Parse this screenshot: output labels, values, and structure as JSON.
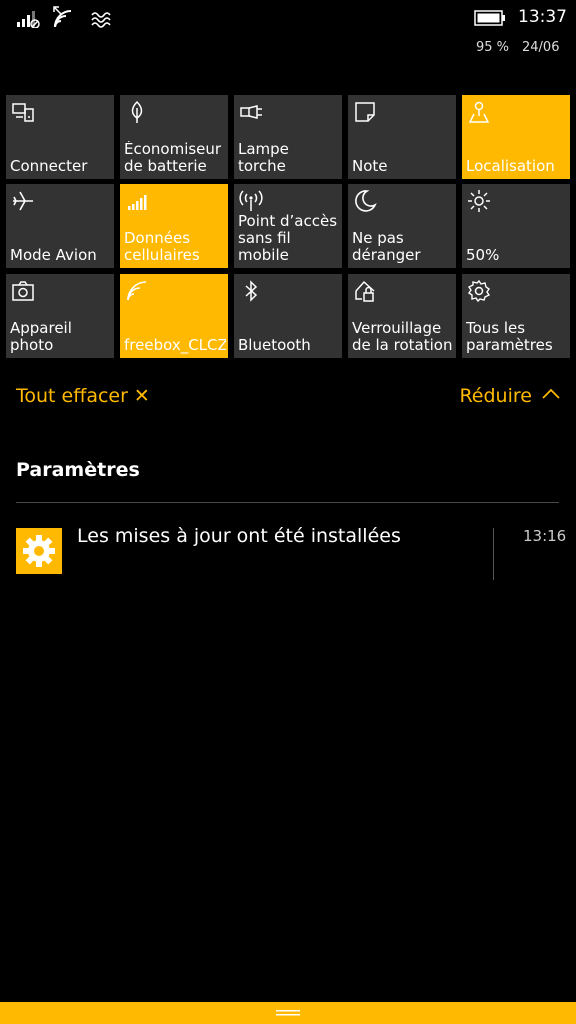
{
  "status": {
    "time": "13:37",
    "battery_percent": "95 %",
    "date": "24/06"
  },
  "tiles": [
    {
      "label": "Connecter",
      "icon": "connect-icon",
      "active": false
    },
    {
      "label": "Économiseur\nde batterie",
      "icon": "battery-saver-icon",
      "active": false
    },
    {
      "label": "Lampe torche",
      "icon": "flashlight-icon",
      "active": false
    },
    {
      "label": "Note",
      "icon": "note-icon",
      "active": false
    },
    {
      "label": "Localisation",
      "icon": "location-icon",
      "active": true
    },
    {
      "label": "Mode Avion",
      "icon": "airplane-icon",
      "active": false
    },
    {
      "label": "Données\ncellulaires",
      "icon": "cellular-icon",
      "active": true
    },
    {
      "label": "Point d’accès\nsans fil mobile",
      "icon": "hotspot-icon",
      "active": false
    },
    {
      "label": "Ne pas\ndéranger",
      "icon": "moon-icon",
      "active": false
    },
    {
      "label": "50%",
      "icon": "brightness-icon",
      "active": false
    },
    {
      "label": "Appareil\nphoto",
      "icon": "camera-icon",
      "active": false
    },
    {
      "label": "freebox_CLCZ",
      "icon": "wifi-icon",
      "active": true
    },
    {
      "label": "Bluetooth",
      "icon": "bluetooth-icon",
      "active": false
    },
    {
      "label": "Verrouillage\nde la rotation",
      "icon": "rotation-lock-icon",
      "active": false
    },
    {
      "label": "Tous les\nparamètres",
      "icon": "settings-icon",
      "active": false
    }
  ],
  "actions": {
    "clear_all": "Tout effacer",
    "clear_all_glyph": "✕",
    "collapse": "Réduire",
    "collapse_glyph": "︿"
  },
  "section": {
    "title": "Paramètres"
  },
  "notification": {
    "text": "Les mises à jour ont été installées",
    "time": "13:16",
    "icon": "gear-icon"
  },
  "colors": {
    "accent": "#FFB900",
    "tile": "#333333",
    "background": "#000000"
  }
}
